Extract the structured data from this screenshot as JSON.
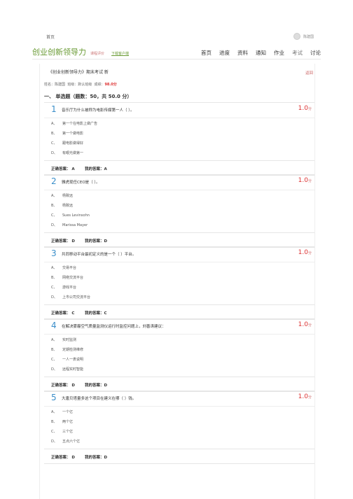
{
  "header": {
    "home_link": "首页",
    "user_name": "陈建国",
    "course_title": "创业创新领导力",
    "course_sub": "课程评价",
    "download_link": "下载客户端",
    "nav": [
      "首页",
      "进度",
      "资料",
      "通知",
      "作业",
      "考试",
      "讨论"
    ]
  },
  "exam": {
    "title": "《创业创新领导力》期末考试 新",
    "back_link": "返回",
    "info_name_label": "姓名：",
    "info_name": "陈建国",
    "info_class_label": "班级：",
    "info_class": "默认班级",
    "info_score_label": "成绩：",
    "info_score": "98.0分",
    "section_title": "一、 单选题（题数：50，共 50.0 分）"
  },
  "questions": [
    {
      "num": "1",
      "text": "音乐厅为什么被称为电影传媒第一人（ ）。",
      "score": "1.0",
      "unit": "分",
      "options": [
        {
          "letter": "A、",
          "text": "第一个在电影上做广告"
        },
        {
          "letter": "B、",
          "text": "第一个做电影"
        },
        {
          "letter": "C、",
          "text": "跟电影做得好"
        },
        {
          "letter": "D、",
          "text": "有眼光做第一"
        }
      ],
      "correct": "正确答案：  A",
      "mine": "我的答案：A"
    },
    {
      "num": "2",
      "text": "雅虎现任CEO是（ ）。",
      "score": "1.0",
      "unit": "分",
      "options": [
        {
          "letter": "A、",
          "text": "杨致远"
        },
        {
          "letter": "B、",
          "text": "杨致远"
        },
        {
          "letter": "C、",
          "text": "Sues Levinsohn"
        },
        {
          "letter": "D、",
          "text": "Marissa Mayer"
        }
      ],
      "correct": "正确答案：  D",
      "mine": "我的答案：D"
    },
    {
      "num": "3",
      "text": "共同移动平台最初定义的是一个（ ）平台。",
      "score": "1.0",
      "unit": "分",
      "options": [
        {
          "letter": "A、",
          "text": "交易平台"
        },
        {
          "letter": "B、",
          "text": "网络交流平台"
        },
        {
          "letter": "C、",
          "text": "游戏平台"
        },
        {
          "letter": "D、",
          "text": "上市公司交流平台"
        }
      ],
      "correct": "正确答案：  C",
      "mine": "我的答案：C"
    },
    {
      "num": "4",
      "text": "在解决雾霾空气质量监测仪运行时监控问题上，刘善涛建议：",
      "score": "1.0",
      "unit": "分",
      "options": [
        {
          "letter": "A、",
          "text": "实时监测"
        },
        {
          "letter": "B、",
          "text": "定期检测维修"
        },
        {
          "letter": "C、",
          "text": "一人一表说明"
        },
        {
          "letter": "D、",
          "text": "远程实时智能"
        }
      ],
      "correct": "正确答案：  D",
      "mine": "我的答案：D"
    },
    {
      "num": "5",
      "text": "大唐贝塔量多这个项目在建义在哪（ ）钱。",
      "score": "1.0",
      "unit": "分",
      "options": [
        {
          "letter": "A、",
          "text": "一个亿"
        },
        {
          "letter": "B、",
          "text": "两个亿"
        },
        {
          "letter": "C、",
          "text": "三个亿"
        },
        {
          "letter": "D、",
          "text": "五点六个亿"
        }
      ],
      "correct": "正确答案：  D",
      "mine": "我的答案：D"
    }
  ]
}
